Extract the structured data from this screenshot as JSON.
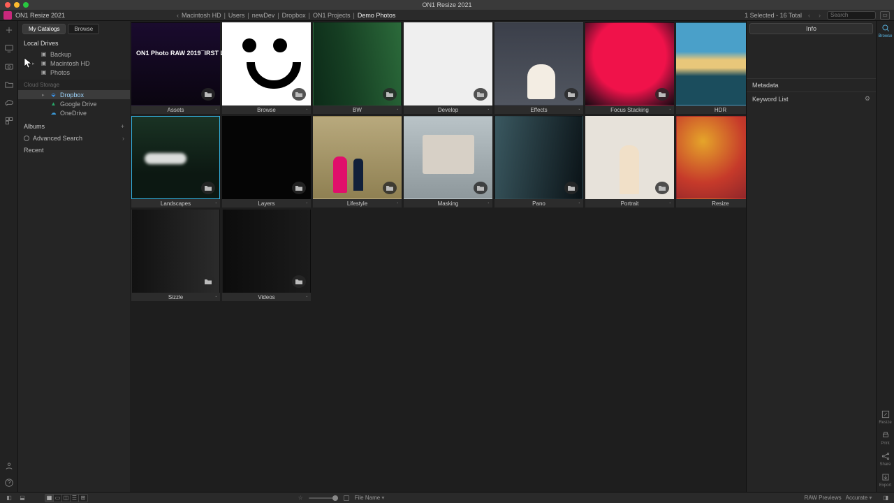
{
  "window": {
    "title": "ON1 Resize 2021",
    "appname": "ON1 Resize 2021"
  },
  "breadcrumbs": [
    "Macintosh HD",
    "Users",
    "newDev",
    "Dropbox",
    "ON1 Projects",
    "Demo Photos"
  ],
  "status": "1 Selected - 16 Total",
  "search_placeholder": "Search",
  "left_tabs": {
    "a": "My Catalogs",
    "b": "Browse"
  },
  "local_drives_label": "Local Drives",
  "drives": {
    "backup": "Backup",
    "machd": "Macintosh HD",
    "photos": "Photos"
  },
  "cloud_label": "Cloud Storage",
  "cloud": {
    "dropbox": "Dropbox",
    "gdrive": "Google Drive",
    "onedrive": "OneDrive"
  },
  "albums_label": "Albums",
  "adv_search": "Advanced Search",
  "recent": "Recent",
  "folders": [
    {
      "name": "Assets",
      "cls": "t-assets"
    },
    {
      "name": "Browse",
      "cls": "t-browse"
    },
    {
      "name": "BW",
      "cls": "t-bw"
    },
    {
      "name": "Develop",
      "cls": "t-dev"
    },
    {
      "name": "Effects",
      "cls": "t-eff"
    },
    {
      "name": "Focus Stacking",
      "cls": "t-focus"
    },
    {
      "name": "HDR",
      "cls": "t-hdr"
    },
    {
      "name": "Landscapes",
      "cls": "t-land",
      "selected": true
    },
    {
      "name": "Layers",
      "cls": "t-layers"
    },
    {
      "name": "Lifestyle",
      "cls": "t-life"
    },
    {
      "name": "Masking",
      "cls": "t-mask"
    },
    {
      "name": "Pano",
      "cls": "t-pano"
    },
    {
      "name": "Portrait",
      "cls": "t-port"
    },
    {
      "name": "Resize",
      "cls": "t-resize"
    },
    {
      "name": "Sizzle",
      "cls": "t-sizzle"
    },
    {
      "name": "Videos",
      "cls": "t-videos"
    }
  ],
  "right": {
    "info": "Info",
    "metadata": "Metadata",
    "keyword": "Keyword List"
  },
  "rtools": {
    "browse": "Browse",
    "resize": "Resize",
    "print": "Print",
    "share": "Share",
    "export": "Export"
  },
  "footer": {
    "sort": "File Name",
    "raw": "RAW Previews",
    "acc": "Accurate"
  }
}
